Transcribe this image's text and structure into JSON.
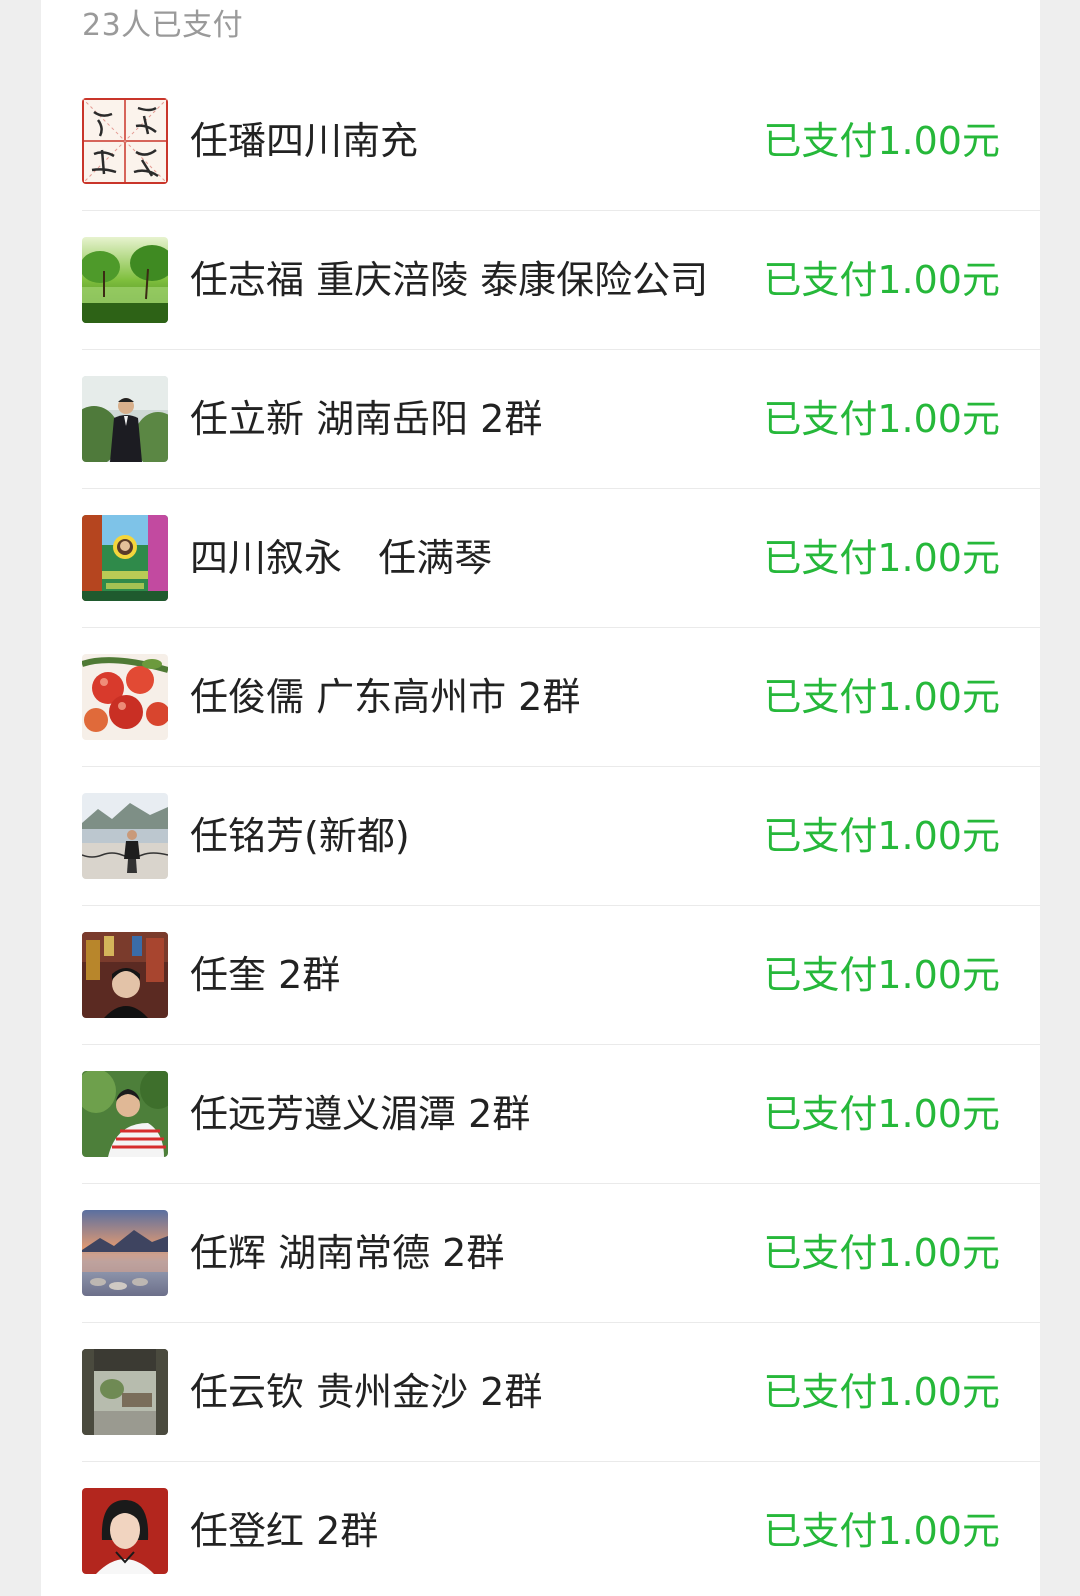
{
  "summary": "23人已支付",
  "accent_green": "#26b83a",
  "rows": [
    {
      "name": "任璠四川南充",
      "status": "已支付1.00元",
      "avatar": "calligraphy-avatar"
    },
    {
      "name": "任志福 重庆涪陵 泰康保险公司",
      "status": "已支付1.00元",
      "avatar": "green-forest-avatar"
    },
    {
      "name": "任立新 湖南岳阳 2群",
      "status": "已支付1.00元",
      "avatar": "man-suit-outdoor-avatar"
    },
    {
      "name": "四川叙永   任满琴",
      "status": "已支付1.00元",
      "avatar": "colorful-garden-avatar"
    },
    {
      "name": "任俊儒 广东高州市 2群",
      "status": "已支付1.00元",
      "avatar": "red-fruit-avatar"
    },
    {
      "name": "任铭芳(新都)",
      "status": "已支付1.00元",
      "avatar": "riverside-portrait-avatar"
    },
    {
      "name": "任奎 2群",
      "status": "已支付1.00元",
      "avatar": "shop-portrait-avatar"
    },
    {
      "name": "任远芳遵义湄潭 2群",
      "status": "已支付1.00元",
      "avatar": "man-striped-shirt-avatar"
    },
    {
      "name": "任辉 湖南常德 2群",
      "status": "已支付1.00元",
      "avatar": "lake-sunset-avatar"
    },
    {
      "name": "任云钦 贵州金沙 2群",
      "status": "已支付1.00元",
      "avatar": "gate-scene-avatar"
    },
    {
      "name": "任登红 2群",
      "status": "已支付1.00元",
      "avatar": "woman-portrait-avatar"
    }
  ]
}
